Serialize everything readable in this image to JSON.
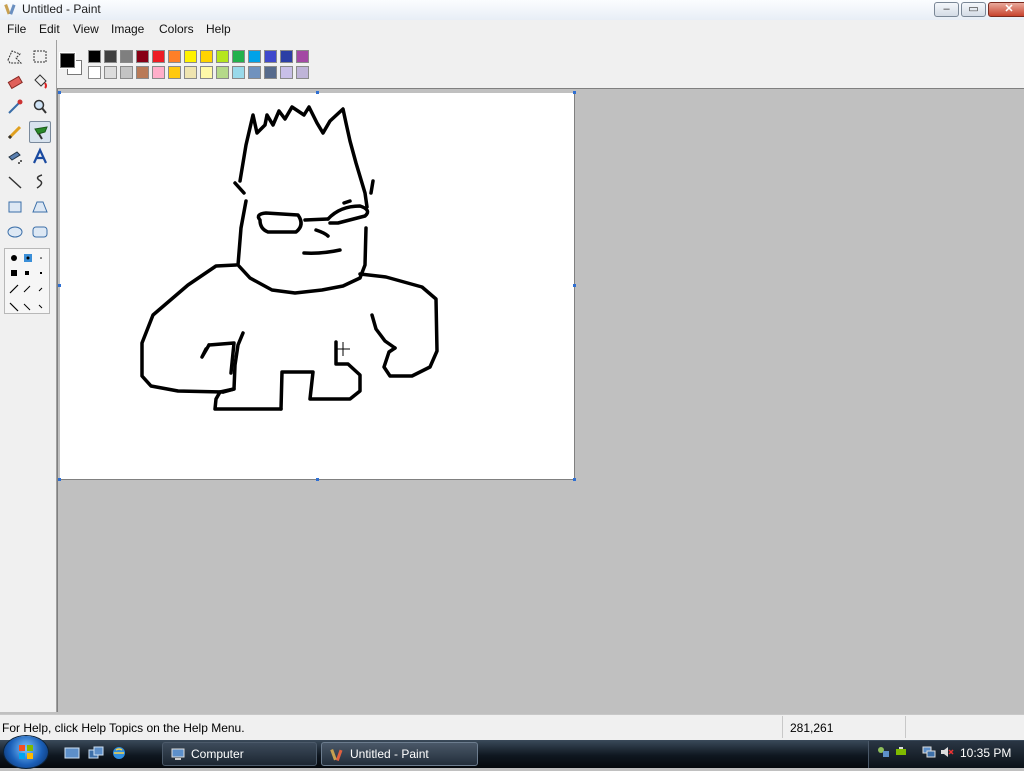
{
  "window": {
    "title": "Untitled - Paint",
    "controls": {
      "minimize": "–",
      "maximize": "▭",
      "close": "✕"
    }
  },
  "menu": [
    "File",
    "Edit",
    "View",
    "Image",
    "Colors",
    "Help"
  ],
  "tools": [
    {
      "name": "free-form-select-icon",
      "selected": false
    },
    {
      "name": "select-icon",
      "selected": false
    },
    {
      "name": "eraser-icon",
      "selected": false
    },
    {
      "name": "fill-bucket-icon",
      "selected": false
    },
    {
      "name": "pick-color-icon",
      "selected": false
    },
    {
      "name": "magnifier-icon",
      "selected": false
    },
    {
      "name": "pencil-icon",
      "selected": false
    },
    {
      "name": "brush-icon",
      "selected": true
    },
    {
      "name": "airbrush-icon",
      "selected": false
    },
    {
      "name": "text-icon",
      "selected": false
    },
    {
      "name": "line-icon",
      "selected": false
    },
    {
      "name": "curve-icon",
      "selected": false
    },
    {
      "name": "rectangle-icon",
      "selected": false
    },
    {
      "name": "polygon-icon",
      "selected": false
    },
    {
      "name": "ellipse-icon",
      "selected": false
    },
    {
      "name": "rounded-rectangle-icon",
      "selected": false
    }
  ],
  "palette": {
    "foreground": "#000000",
    "background": "#ffffff",
    "row1": [
      "#000000",
      "#404040",
      "#7f7f7f",
      "#880015",
      "#ed1c24",
      "#ff7f27",
      "#fff200",
      "#ffd400",
      "#b5e61d",
      "#22b14c",
      "#00a2e8",
      "#3f48cc",
      "#2b3ea5",
      "#a349a4"
    ],
    "row2": [
      "#ffffff",
      "#dcdcdc",
      "#c3c3c3",
      "#b97a57",
      "#ffaec9",
      "#ffc90e",
      "#efe4b0",
      "#fff9a8",
      "#b5d98a",
      "#99d9ea",
      "#7092be",
      "#566a8c",
      "#c8bfe7",
      "#bfb4d8"
    ]
  },
  "status": {
    "help_text": "For Help, click Help Topics on the Help Menu.",
    "coords": "281,261"
  },
  "taskbar": {
    "tasks": [
      {
        "label": "Computer",
        "active": false
      },
      {
        "label": "Untitled - Paint",
        "active": true
      }
    ],
    "clock": "10:35 PM"
  }
}
